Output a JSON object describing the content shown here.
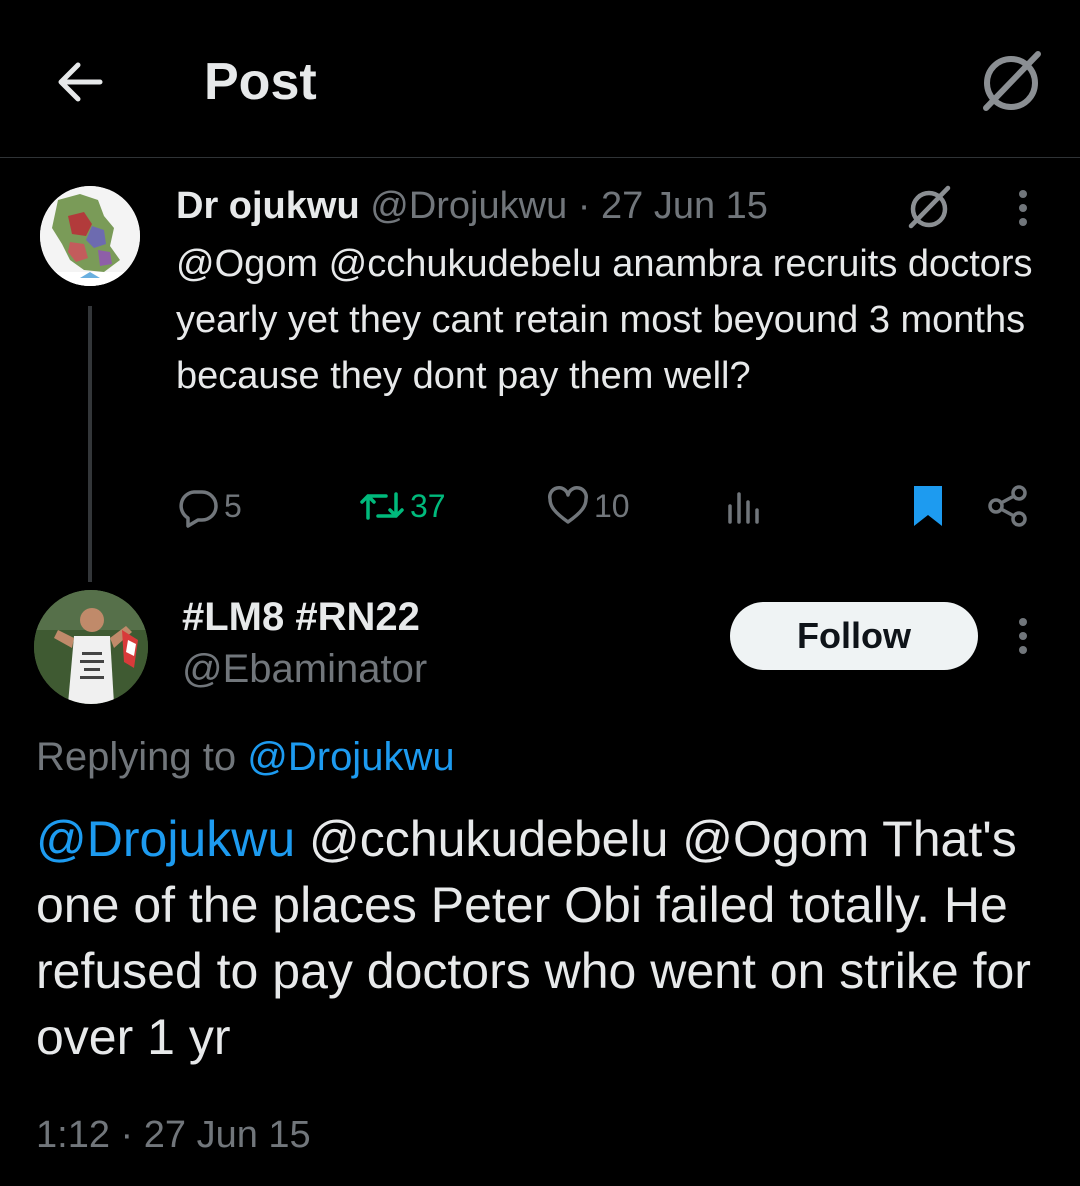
{
  "header": {
    "title": "Post",
    "back_icon": "arrow-left-icon",
    "grok_icon": "grok-icon"
  },
  "parent_tweet": {
    "author_name": "Dr ojukwu",
    "handle": "@Drojukwu",
    "separator": "·",
    "date": "27 Jun 15",
    "text": "@Ogom @cchukudebelu anambra recruits doctors yearly yet they cant retain most beyound 3 months because they dont pay them well?",
    "actions": {
      "replies": "5",
      "retweets": "37",
      "likes": "10",
      "views": ""
    }
  },
  "reply_tweet": {
    "author_name": "#LM8 #RN22",
    "handle": "@Ebaminator",
    "follow_label": "Follow",
    "replying_prefix": "Replying to",
    "replying_to": "@Drojukwu",
    "mention_link": "@Drojukwu",
    "text_rest": " @cchukudebelu @Ogom That's one of the places Peter Obi failed totally. He refused to pay doctors who went on strike for over 1 yr",
    "time": "1:12",
    "separator": "·",
    "date": "27 Jun 15"
  },
  "colors": {
    "background": "#000000",
    "text": "#e7e9ea",
    "muted": "#71767b",
    "accent": "#1d9bf0",
    "retweet": "#00ba7c"
  }
}
